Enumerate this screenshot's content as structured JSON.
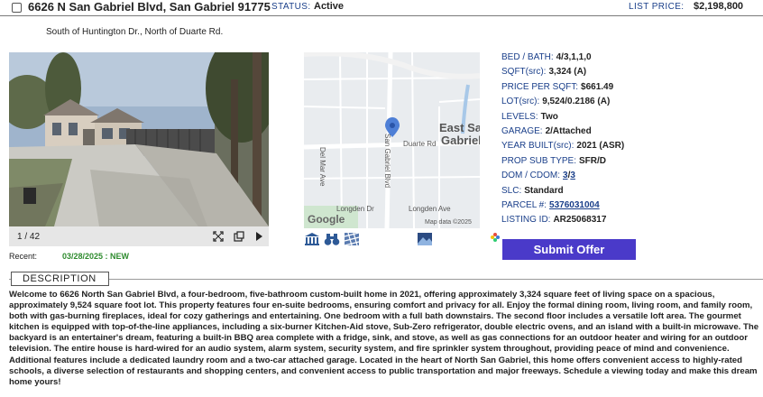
{
  "header": {
    "address": "6626 N San Gabriel Blvd, San Gabriel 91775",
    "status_label": "STATUS:",
    "status_value": "Active",
    "price_label": "LIST PRICE:",
    "price_value": "$2,198,800"
  },
  "directions": "South of Huntington Dr., North of Duarte Rd.",
  "photo": {
    "counter": "1 / 42",
    "controls": [
      "expand-icon",
      "copy-icon",
      "next-icon"
    ]
  },
  "recent": {
    "label": "Recent:",
    "value": "03/28/2025 : NEW"
  },
  "map": {
    "city_label_line1": "East San",
    "city_label_line2": "Gabriel",
    "streets": [
      "Duarte Rd",
      "Del Mar Ave",
      "San Gabriel Blvd",
      "Longden Dr",
      "Longden Ave"
    ],
    "logo": "Google",
    "attribution": "Map data ©2025"
  },
  "tools": [
    "bank-icon",
    "binoculars-icon",
    "satellite-icon",
    "streetview-icon"
  ],
  "details": {
    "bed_bath": {
      "label": "BED / BATH:",
      "value": "4/3,1,1,0"
    },
    "sqft": {
      "label": "SQFT(src):",
      "value": "3,324 (A)"
    },
    "price_per_sqft": {
      "label": "PRICE PER SQFT:",
      "value": "$661.49"
    },
    "lot": {
      "label": "LOT(src):",
      "value": "9,524/0.2186 (A)"
    },
    "levels": {
      "label": "LEVELS:",
      "value": "Two"
    },
    "garage": {
      "label": "GARAGE:",
      "value": "2/Attached"
    },
    "year_built": {
      "label": "YEAR BUILT(src):",
      "value": "2021 (ASR)"
    },
    "prop_sub_type": {
      "label": "PROP SUB TYPE:",
      "value": "SFR/D"
    },
    "dom_cdom": {
      "label": "DOM / CDOM:",
      "value_dom": "3",
      "separator": "/",
      "value_cdom": "3"
    },
    "slc": {
      "label": "SLC:",
      "value": "Standard"
    },
    "parcel": {
      "label": "PARCEL #:",
      "value": "5376031004"
    },
    "listing_id": {
      "label": "LISTING ID:",
      "value": "AR25068317"
    }
  },
  "submit_offer_label": "Submit Offer",
  "description": {
    "title": "DESCRIPTION",
    "text": "Welcome to 6626 North San Gabriel Blvd, a four-bedroom, five-bathroom custom-built home in 2021, offering approximately 3,324 square feet of living space on a spacious, approximately 9,524 square foot lot. This property features four en-suite bedrooms, ensuring comfort and privacy for all. Enjoy the formal dining room, living room, and family room, both with gas-burning fireplaces, ideal for cozy gatherings and entertaining. One bedroom with a full bath downstairs. The second floor includes a versatile loft area. The gourmet kitchen is equipped with top-of-the-line appliances, including a six-burner Kitchen-Aid stove, Sub-Zero refrigerator, double electric ovens, and an island with a built-in microwave. The backyard is an entertainer's dream, featuring a built-in BBQ area complete with a fridge, sink, and stove, as well as gas connections for an outdoor heater and wiring for an outdoor television. The entire house is hard-wired for an audio system, alarm system, security system, and fire sprinkler system throughout, providing peace of mind and convenience. Additional features include a dedicated laundry room and a two-car attached garage. Located in the heart of North San Gabriel, this home offers convenient access to highly-rated schools, a diverse selection of restaurants and shopping centers, and convenient access to public transportation and major freeways. Schedule a viewing today and make this dream home yours!"
  },
  "colors": {
    "label_blue": "#1a3f8a",
    "button_purple": "#4a3ac9",
    "new_green": "#2e8b2e"
  }
}
